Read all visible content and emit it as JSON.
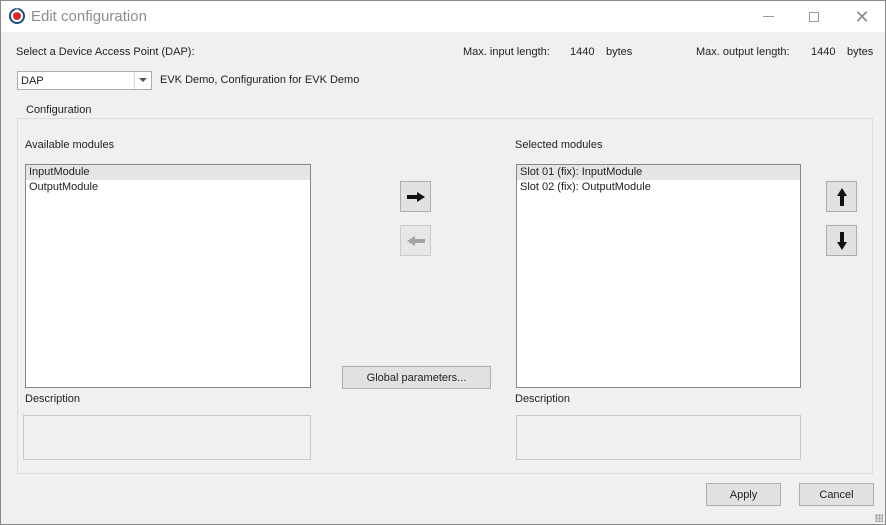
{
  "window": {
    "title": "Edit configuration",
    "icon": "app-logo-icon"
  },
  "dap": {
    "label": "Select a Device Access Point (DAP):",
    "selected": "DAP",
    "description": "EVK Demo, Configuration for EVK Demo"
  },
  "limits": {
    "max_input_label": "Max. input length:",
    "max_input_value": "1440",
    "max_input_unit": "bytes",
    "max_output_label": "Max. output length:",
    "max_output_value": "1440",
    "max_output_unit": "bytes"
  },
  "configuration": {
    "title": "Configuration",
    "available": {
      "label": "Available modules",
      "items": [
        "InputModule",
        "OutputModule"
      ],
      "selected_index": 0,
      "description_label": "Description",
      "description_text": ""
    },
    "selected": {
      "label": "Selected modules",
      "items": [
        "Slot 01 (fix): InputModule",
        "Slot 02 (fix): OutputModule"
      ],
      "selected_index": 0,
      "description_label": "Description",
      "description_text": ""
    },
    "global_parameters_label": "Global parameters..."
  },
  "footer": {
    "apply_label": "Apply",
    "cancel_label": "Cancel"
  }
}
